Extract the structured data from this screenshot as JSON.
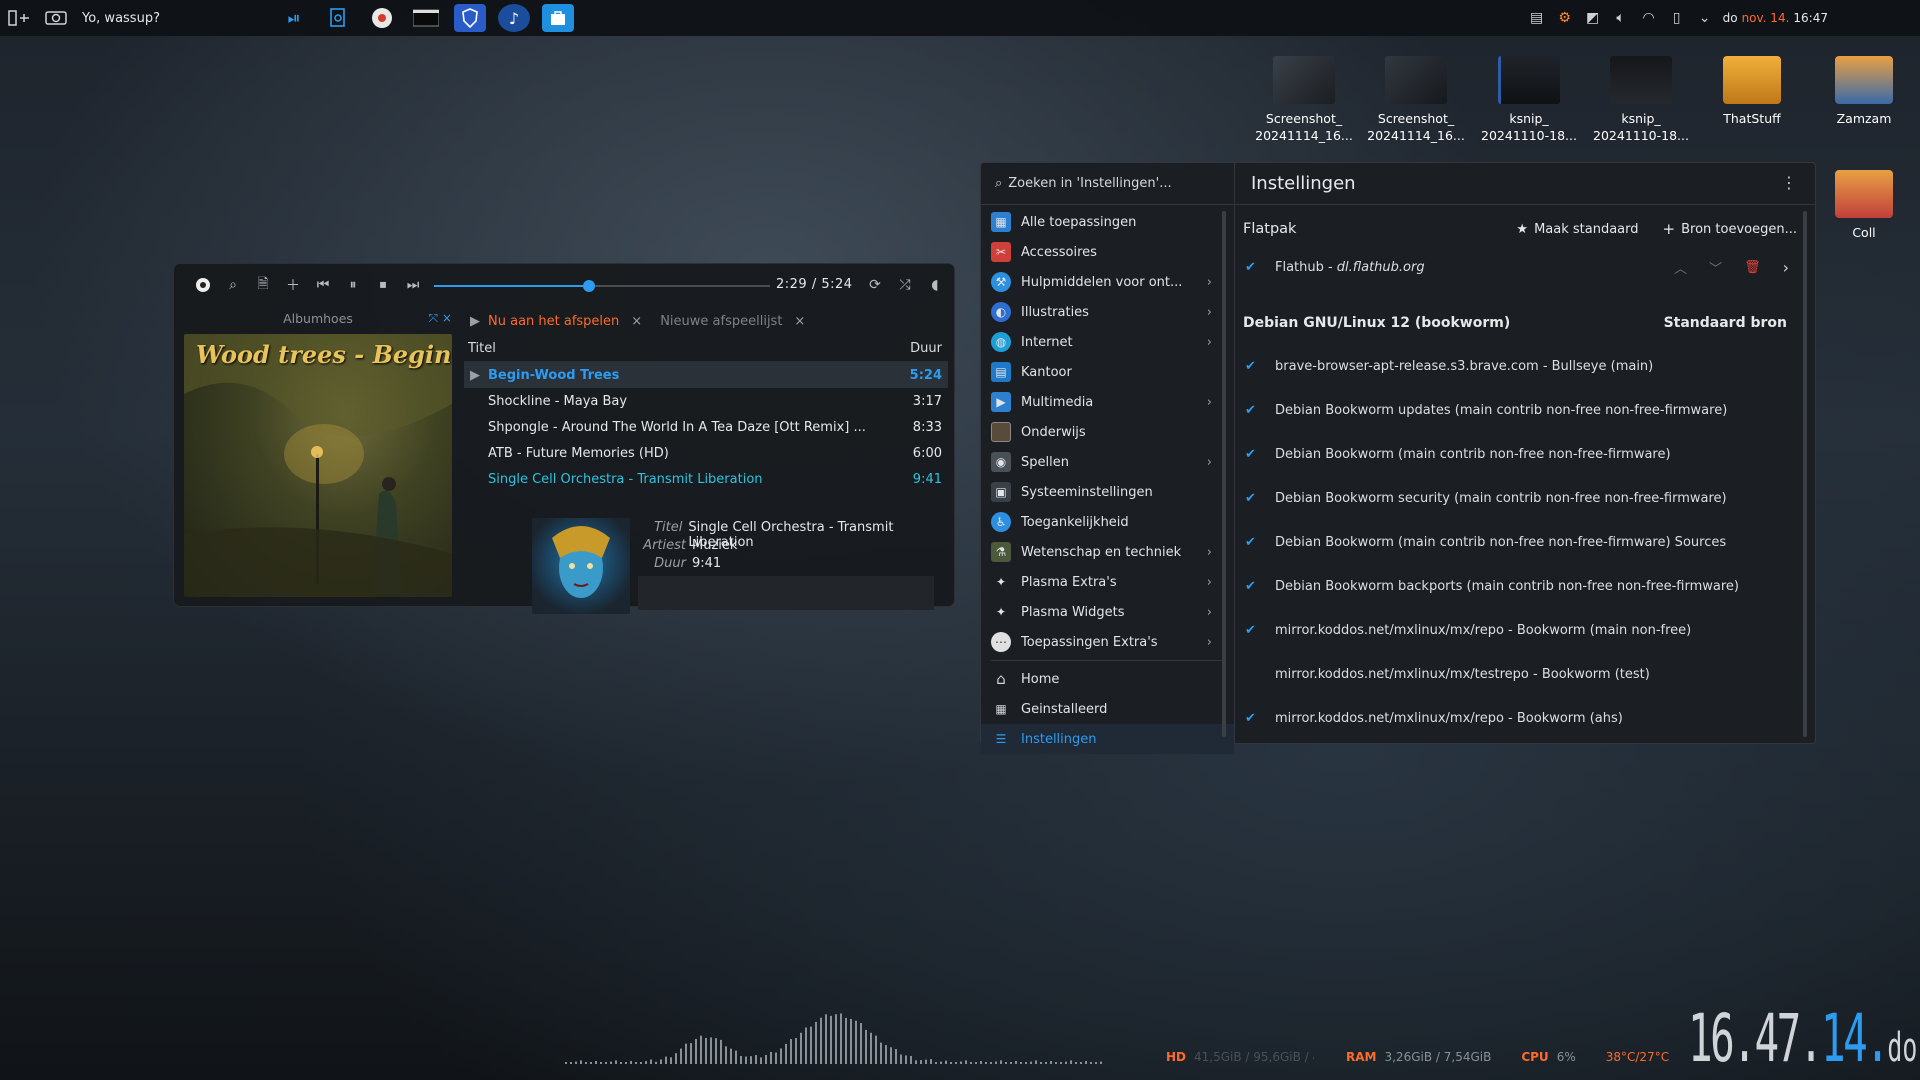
{
  "top_panel": {
    "greeting": "Yo, wassup?",
    "date_prefix": "do",
    "date_highlight": "nov. 14.",
    "time": "16:47"
  },
  "desktop_icons": [
    {
      "line1": "Screenshot_",
      "line2": "20241114_16..."
    },
    {
      "line1": "Screenshot_",
      "line2": "20241114_16..."
    },
    {
      "line1": "ksnip_",
      "line2": "20241110-18..."
    },
    {
      "line1": "ksnip_",
      "line2": "20241110-18..."
    },
    {
      "line1": "ThatStuff",
      "line2": ""
    },
    {
      "line1": "Zamzam",
      "line2": ""
    },
    {
      "line1": "Coll",
      "line2": ""
    }
  ],
  "player": {
    "time": "2:29 / 5:24",
    "progress": 0.46,
    "album_header": "Albumhoes",
    "album_title": "Wood trees - Begin",
    "tab_now": "Nu aan het afspelen",
    "tab_new": "Nieuwe afspeellijst",
    "col_title": "Titel",
    "col_duration": "Duur",
    "tracks": [
      {
        "title": "Begin-Wood Trees",
        "duration": "5:24"
      },
      {
        "title": "Shockline - Maya Bay",
        "duration": "3:17"
      },
      {
        "title": "Shpongle - Around The World In A Tea Daze [Ott Remix] ...",
        "duration": "8:33"
      },
      {
        "title": "ATB - Future Memories (HD)",
        "duration": "6:00"
      },
      {
        "title": "Single Cell Orchestra - Transmit Liberation",
        "duration": "9:41"
      }
    ],
    "now": {
      "title_key": "Titel",
      "title_val": "Single Cell Orchestra - Transmit Liberation",
      "artist_key": "Artiest",
      "artist_val": "Muziek",
      "duration_key": "Duur",
      "duration_val": "9:41"
    }
  },
  "discover": {
    "search_placeholder": "Zoeken in 'Instellingen'...",
    "title": "Instellingen",
    "categories": [
      {
        "label": "Alle toepassingen",
        "arrow": false
      },
      {
        "label": "Accessoires",
        "arrow": false
      },
      {
        "label": "Hulpmiddelen voor ont...",
        "arrow": true
      },
      {
        "label": "Illustraties",
        "arrow": true
      },
      {
        "label": "Internet",
        "arrow": true
      },
      {
        "label": "Kantoor",
        "arrow": false
      },
      {
        "label": "Multimedia",
        "arrow": true
      },
      {
        "label": "Onderwijs",
        "arrow": false
      },
      {
        "label": "Spellen",
        "arrow": true
      },
      {
        "label": "Systeeminstellingen",
        "arrow": false
      },
      {
        "label": "Toegankelijkheid",
        "arrow": false
      },
      {
        "label": "Wetenschap en techniek",
        "arrow": true
      },
      {
        "label": "Plasma Extra's",
        "arrow": true
      },
      {
        "label": "Plasma Widgets",
        "arrow": true
      },
      {
        "label": "Toepassingen Extra's",
        "arrow": true
      }
    ],
    "nav": [
      {
        "label": "Home"
      },
      {
        "label": "Geinstalleerd"
      },
      {
        "label": "Instellingen"
      }
    ],
    "flatpak_label": "Flatpak",
    "make_default": "Maak standaard",
    "add_source": "Bron toevoegen...",
    "flathub_name": "Flathub - ",
    "flathub_url": "dl.flathub.org",
    "debian_header": "Debian GNU/Linux 12 (bookworm)",
    "default_source": "Standaard bron",
    "sources": [
      {
        "label": "brave-browser-apt-release.s3.brave.com - Bullseye (main)",
        "checked": true
      },
      {
        "label": "Debian Bookworm updates (main contrib non-free non-free-firmware)",
        "checked": true
      },
      {
        "label": "Debian Bookworm (main contrib non-free non-free-firmware)",
        "checked": true
      },
      {
        "label": "Debian Bookworm security (main contrib non-free non-free-firmware)",
        "checked": true
      },
      {
        "label": "Debian Bookworm (main contrib non-free non-free-firmware) Sources",
        "checked": true
      },
      {
        "label": "Debian Bookworm backports (main contrib non-free non-free-firmware)",
        "checked": true
      },
      {
        "label": "mirror.koddos.net/mxlinux/mx/repo - Bookworm (main non-free)",
        "checked": true
      },
      {
        "label": "mirror.koddos.net/mxlinux/mx/testrepo - Bookworm (test)",
        "checked": false
      },
      {
        "label": "mirror.koddos.net/mxlinux/mx/repo - Bookworm (ahs)",
        "checked": true
      }
    ]
  },
  "sysmon": {
    "hd_label": "HD",
    "hd_value": "41,5GiB / 95,6GiB / 4...",
    "ram_label": "RAM",
    "ram_value": "3,26GiB / 7,54GiB",
    "cpu_label": "CPU",
    "cpu_value": "6%",
    "temp": "38°C/27°C"
  },
  "clock": {
    "hm": "16.47.",
    "day": "14.",
    "weekday": "do"
  },
  "colors": {
    "accent": "#2d9bf0",
    "orange": "#ff6a2a",
    "cyan": "#2ec4e0"
  }
}
